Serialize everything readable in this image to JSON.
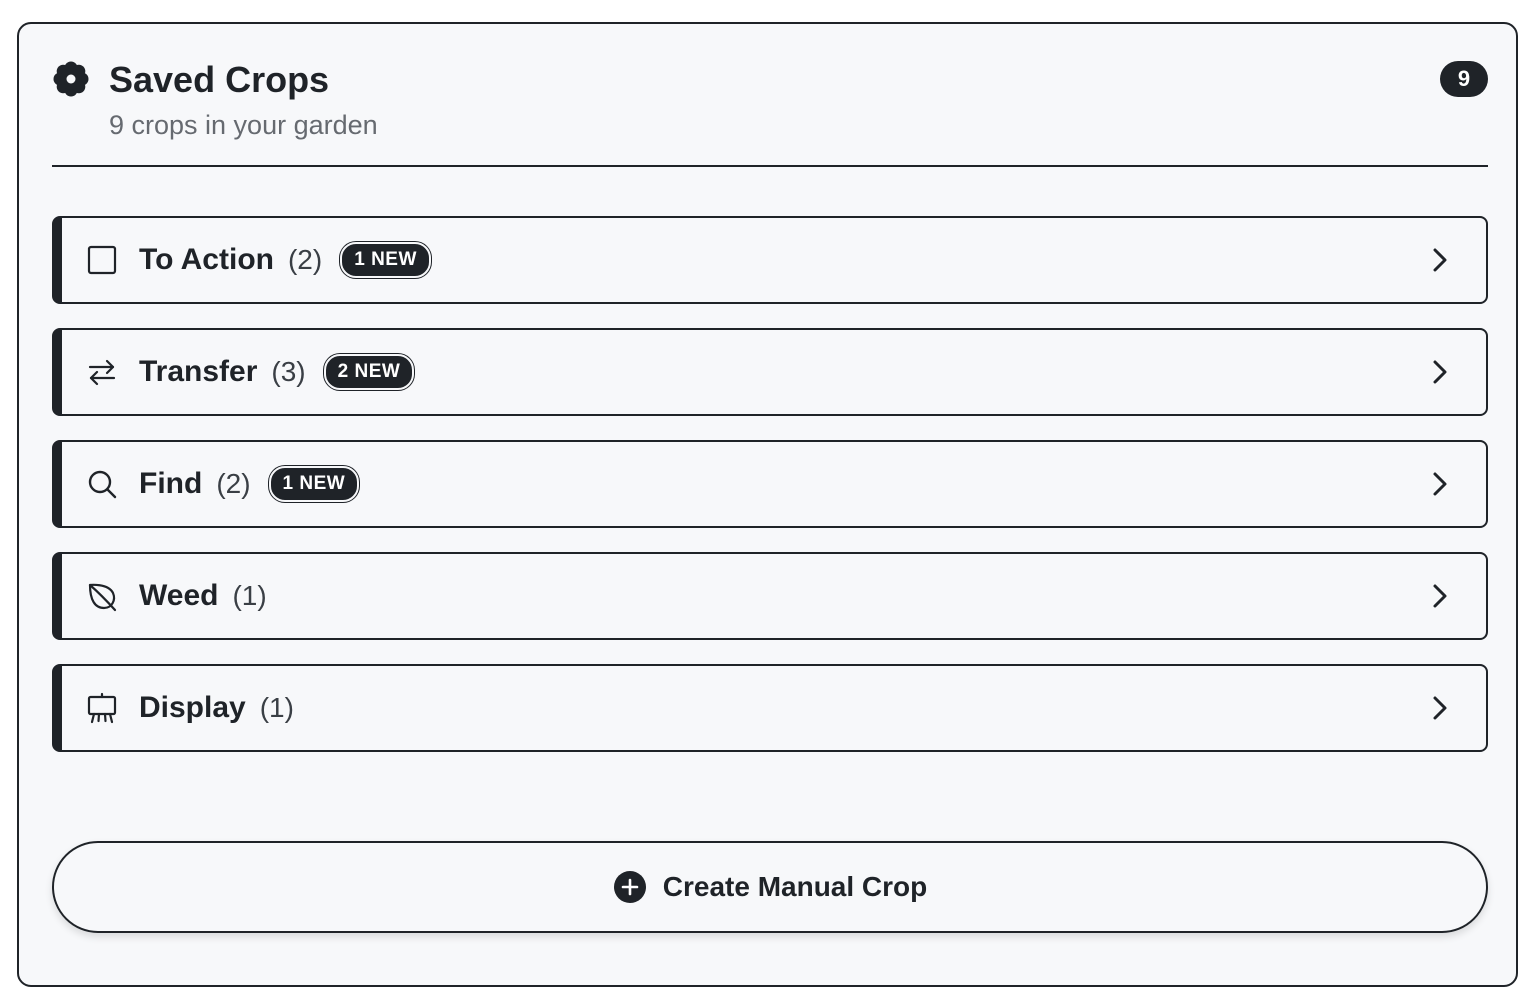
{
  "header": {
    "icon": "gear-flower-icon",
    "title": "Saved Crops",
    "subtitle": "9 crops in your garden",
    "count_badge": "9"
  },
  "categories": [
    {
      "icon": "checkbox-icon",
      "label": "To Action",
      "count": "(2)",
      "new_badge": "1 NEW"
    },
    {
      "icon": "transfer-arrows-icon",
      "label": "Transfer",
      "count": "(3)",
      "new_badge": "2 NEW"
    },
    {
      "icon": "search-icon",
      "label": "Find",
      "count": "(2)",
      "new_badge": "1 NEW"
    },
    {
      "icon": "leaf-icon",
      "label": "Weed",
      "count": "(1)",
      "new_badge": null
    },
    {
      "icon": "easel-icon",
      "label": "Display",
      "count": "(1)",
      "new_badge": null
    }
  ],
  "create_button": {
    "icon": "plus-circle-icon",
    "label": "Create Manual Crop"
  },
  "colors": {
    "ink": "#1f2328",
    "panel_bg": "#f7f8fa",
    "muted_text": "#666a70"
  }
}
